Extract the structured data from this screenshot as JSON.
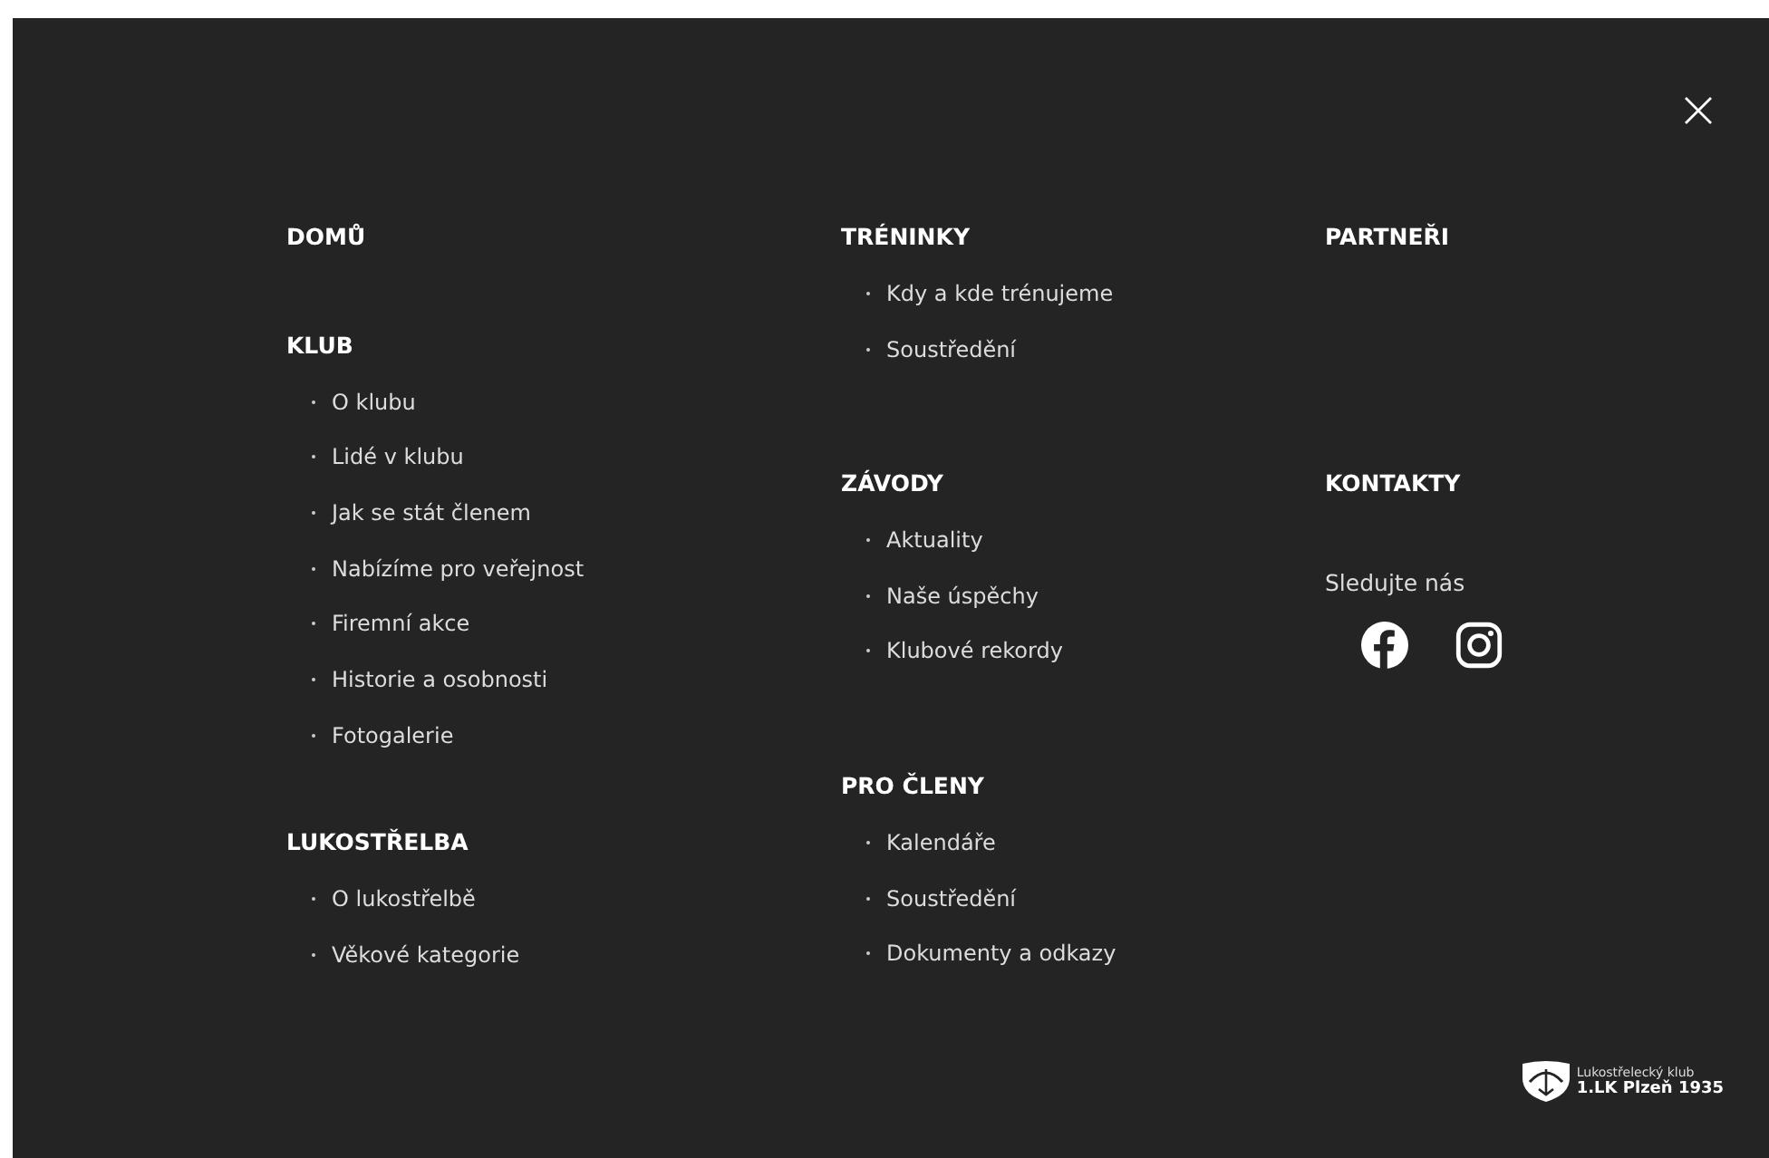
{
  "columns": [
    {
      "sections": [
        {
          "heading": "DOMŮ"
        },
        {
          "heading": "KLUB",
          "items": [
            "O klubu",
            "Lidé v klubu",
            "Jak se stát členem",
            "Nabízíme pro veřejnost",
            "Firemní akce",
            "Historie a osobnosti",
            "Fotogalerie"
          ]
        },
        {
          "heading": "LUKOSTŘELBA",
          "items": [
            "O lukostřelbě",
            "Věkové kategorie"
          ]
        }
      ]
    },
    {
      "sections": [
        {
          "heading": "TRÉNINKY",
          "items": [
            "Kdy a kde trénujeme",
            "Soustředění"
          ]
        },
        {
          "heading": "ZÁVODY",
          "items": [
            "Aktuality",
            "Naše úspěchy",
            "Klubové rekordy"
          ]
        },
        {
          "heading": "PRO ČLENY",
          "items": [
            "Kalendáře",
            "Soustředění",
            "Dokumenty a odkazy"
          ]
        }
      ]
    },
    {
      "sections": [
        {
          "heading": "PARTNEŘI"
        },
        {
          "heading": "KONTAKTY"
        }
      ]
    }
  ],
  "social": {
    "label": "Sledujte nás",
    "networks": [
      {
        "kind": "facebook"
      },
      {
        "kind": "instagram"
      }
    ]
  },
  "logo": {
    "line_1": "Lukostřelecký klub",
    "line_2": "1.LK Plzeň 1935"
  }
}
